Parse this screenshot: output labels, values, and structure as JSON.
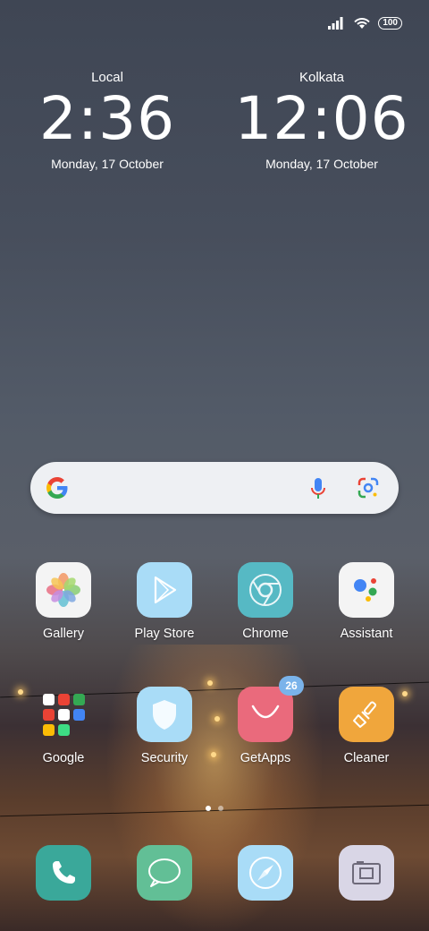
{
  "status_bar": {
    "battery": "100"
  },
  "clocks": [
    {
      "city": "Local",
      "time": "2:36",
      "date": "Monday, 17 October"
    },
    {
      "city": "Kolkata",
      "time": "12:06",
      "date": "Monday, 17 October"
    }
  ],
  "apps_row1": [
    {
      "label": "Gallery",
      "icon": "gallery-icon"
    },
    {
      "label": "Play Store",
      "icon": "play-store-icon"
    },
    {
      "label": "Chrome",
      "icon": "chrome-icon"
    },
    {
      "label": "Assistant",
      "icon": "assistant-icon"
    }
  ],
  "apps_row2": [
    {
      "label": "Google",
      "icon": "google-folder-icon"
    },
    {
      "label": "Security",
      "icon": "security-icon"
    },
    {
      "label": "GetApps",
      "icon": "getapps-icon",
      "badge": "26"
    },
    {
      "label": "Cleaner",
      "icon": "cleaner-icon"
    }
  ],
  "dock": [
    {
      "icon": "phone-icon"
    },
    {
      "icon": "messages-icon"
    },
    {
      "icon": "browser-icon"
    },
    {
      "icon": "camera-icon"
    }
  ],
  "page_indicator": {
    "pages": 2,
    "current": 1
  },
  "colors": {
    "gallery_bg": "#f4f4f4",
    "playstore_bg": "#a9dcf7",
    "chrome_bg": "#56b9c4",
    "assistant_bg": "#f4f4f4",
    "security_bg": "#a9dcf7",
    "getapps_bg": "#ea6a7c",
    "cleaner_bg": "#f0a63c",
    "phone_bg": "#3aa89a",
    "messages_bg": "#62bf96",
    "browser_bg": "#a9dcf7",
    "camera_bg": "#d9d6e6"
  }
}
